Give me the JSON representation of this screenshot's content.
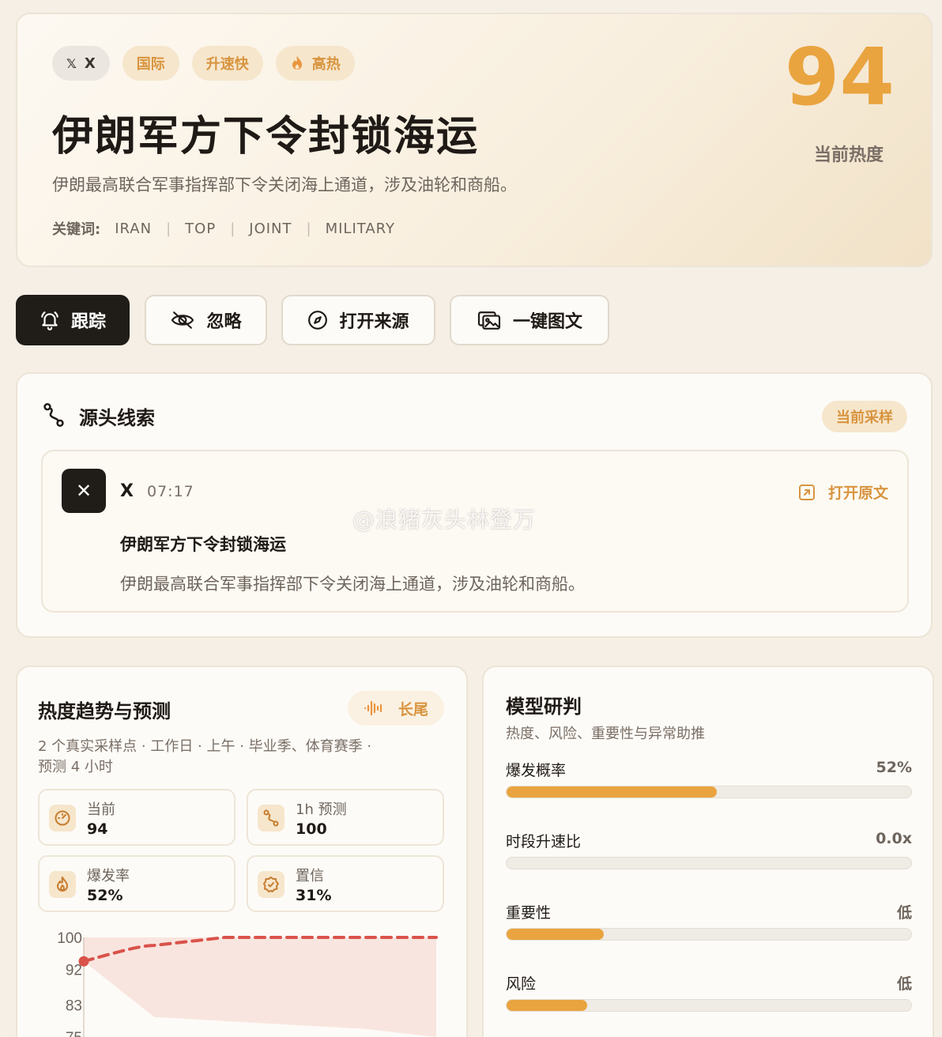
{
  "hero": {
    "tags": [
      {
        "icon": "x-logo-icon",
        "label": "X"
      },
      {
        "label": "国际"
      },
      {
        "label": "升速快"
      },
      {
        "icon": "flame-icon",
        "label": "高热"
      }
    ],
    "title": "伊朗军方下令封锁海运",
    "description": "伊朗最高联合军事指挥部下令关闭海上通道，涉及油轮和商船。",
    "keywords_label": "关键词:",
    "keywords": [
      "IRAN",
      "TOP",
      "JOINT",
      "MILITARY"
    ],
    "heat_score": "94",
    "heat_label": "当前热度"
  },
  "actions": {
    "track": {
      "label": "跟踪",
      "icon": "bell-icon"
    },
    "ignore": {
      "label": "忽略",
      "icon": "eye-off-icon"
    },
    "open_source": {
      "label": "打开来源",
      "icon": "compass-icon"
    },
    "one_click": {
      "label": "一键图文",
      "icon": "images-icon"
    }
  },
  "source": {
    "title": "源头线索",
    "badge": "当前采样",
    "item": {
      "platform": "X",
      "time": "07:17",
      "open_label": "打开原文",
      "headline": "伊朗军方下令封锁海运",
      "summary": "伊朗最高联合军事指挥部下令关闭海上通道，涉及油轮和商船。"
    }
  },
  "trend": {
    "title": "热度趋势与预测",
    "badge": "长尾",
    "meta_line1": "2 个真实采样点 · 工作日 · 上午 · 毕业季、体育赛季 ·",
    "meta_line2": "预测 4 小时",
    "stats": [
      {
        "label": "当前",
        "value": "94",
        "icon": "gauge-icon"
      },
      {
        "label": "1h 预测",
        "value": "100",
        "icon": "route-icon"
      },
      {
        "label": "爆发率",
        "value": "52%",
        "icon": "flame-icon"
      },
      {
        "label": "置信",
        "value": "31%",
        "icon": "badge-check-icon"
      }
    ]
  },
  "chart_data": {
    "type": "line",
    "y_ticks": [
      "100",
      "92",
      "83",
      "75"
    ],
    "ylim": [
      75,
      100
    ],
    "series": [
      {
        "values": [
          94
        ],
        "style": "solid-point"
      },
      {
        "values": [
          94,
          98,
          100,
          100,
          100,
          100
        ],
        "style": "dashed-forecast"
      }
    ],
    "band_upper": [
      100,
      100,
      100,
      100,
      100,
      100
    ],
    "band_lower": [
      94,
      80,
      79,
      78,
      77,
      75
    ]
  },
  "model": {
    "title": "模型研判",
    "subtitle": "热度、风险、重要性与异常助推",
    "bars": [
      {
        "label": "爆发概率",
        "value": "52%",
        "fraction": 0.52
      },
      {
        "label": "时段升速比",
        "value": "0.0x",
        "fraction": 0
      },
      {
        "label": "重要性",
        "value": "低",
        "fraction": 0.24
      },
      {
        "label": "风险",
        "value": "低",
        "fraction": 0.2
      }
    ]
  },
  "watermark": "@浪猪灰头林登万",
  "colors": {
    "accent": "#e9a43f",
    "forecast": "#d9534a",
    "dark": "#201c18"
  }
}
